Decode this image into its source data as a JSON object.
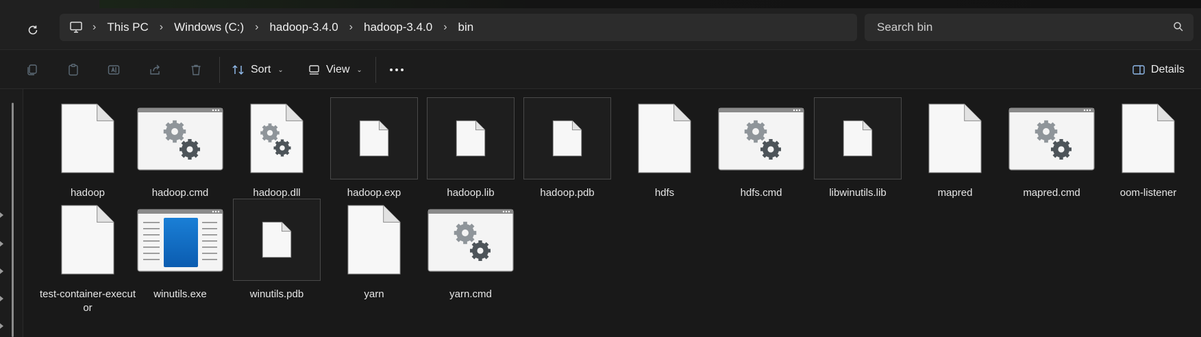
{
  "breadcrumb": {
    "items": [
      "This PC",
      "Windows (C:)",
      "hadoop-3.4.0",
      "hadoop-3.4.0",
      "bin"
    ]
  },
  "search": {
    "placeholder": "Search bin"
  },
  "toolbar": {
    "sort_label": "Sort",
    "view_label": "View",
    "details_label": "Details"
  },
  "icons": {
    "computer": "computer-icon",
    "refresh": "refresh-icon",
    "search": "search-icon"
  },
  "files": [
    {
      "name": "hadoop",
      "type": "file"
    },
    {
      "name": "hadoop.cmd",
      "type": "cmd"
    },
    {
      "name": "hadoop.dll",
      "type": "dll"
    },
    {
      "name": "hadoop.exp",
      "type": "small"
    },
    {
      "name": "hadoop.lib",
      "type": "small"
    },
    {
      "name": "hadoop.pdb",
      "type": "small"
    },
    {
      "name": "hdfs",
      "type": "file"
    },
    {
      "name": "hdfs.cmd",
      "type": "cmd"
    },
    {
      "name": "libwinutils.lib",
      "type": "small"
    },
    {
      "name": "mapred",
      "type": "file"
    },
    {
      "name": "mapred.cmd",
      "type": "cmd"
    },
    {
      "name": "oom-listener",
      "type": "file"
    },
    {
      "name": "test-container-executor",
      "type": "file"
    },
    {
      "name": "winutils.exe",
      "type": "exe"
    },
    {
      "name": "winutils.pdb",
      "type": "small"
    },
    {
      "name": "yarn",
      "type": "file"
    },
    {
      "name": "yarn.cmd",
      "type": "cmd"
    }
  ]
}
